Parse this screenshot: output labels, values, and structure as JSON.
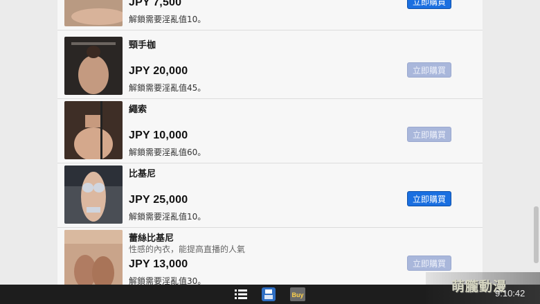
{
  "items": [
    {
      "name": "",
      "desc": "",
      "price": "JPY 7,500",
      "req": "解鎖需要淫亂值10。",
      "button": "立即購買",
      "enabled": true
    },
    {
      "name": "頸手枷",
      "desc": "",
      "price": "JPY 20,000",
      "req": "解鎖需要淫亂值45。",
      "button": "立即購買",
      "enabled": false
    },
    {
      "name": "繩索",
      "desc": "",
      "price": "JPY 10,000",
      "req": "解鎖需要淫亂值60。",
      "button": "立即購買",
      "enabled": false
    },
    {
      "name": "比基尼",
      "desc": "",
      "price": "JPY 25,000",
      "req": "解鎖需要淫亂值10。",
      "button": "立即購買",
      "enabled": true
    },
    {
      "name": "蕾絲比基尼",
      "desc": "性感的內衣，能提高直播的人氣",
      "price": "JPY 13,000",
      "req": "解鎖需要淫亂值30。",
      "button": "立即購買",
      "enabled": false
    }
  ],
  "taskbar": {
    "clock": "9:10:42",
    "store_label": "Buy"
  },
  "watermark": "萌朧動漫",
  "colors": {
    "buy_enabled": "#1a6fe0",
    "buy_disabled": "#a9b7db"
  }
}
